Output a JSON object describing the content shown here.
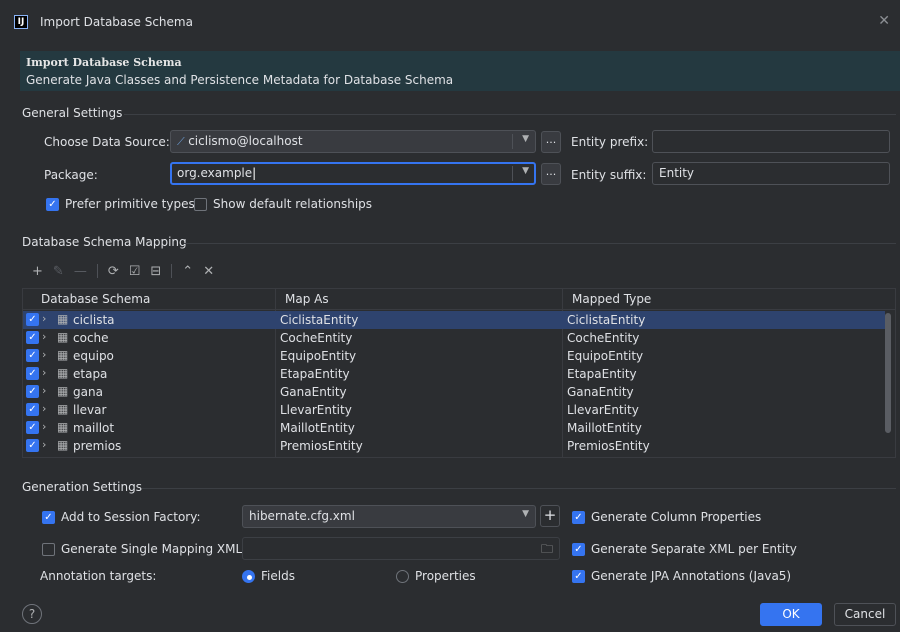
{
  "window": {
    "title": "Import Database Schema",
    "logo": "IJ"
  },
  "banner": {
    "title": "Import Database Schema",
    "description": "Generate Java Classes and Persistence Metadata for Database Schema"
  },
  "general": {
    "section_title": "General Settings",
    "data_source_label": "Choose Data Source:",
    "data_source_value": "ciclismo@localhost",
    "package_label": "Package:",
    "package_value": "org.example",
    "entity_prefix_label": "Entity prefix:",
    "entity_prefix_value": "",
    "entity_suffix_label": "Entity suffix:",
    "entity_suffix_value": "Entity",
    "prefer_primitive_label": "Prefer primitive types",
    "prefer_primitive_checked": true,
    "show_default_rel_label": "Show default relationships",
    "show_default_rel_checked": false,
    "browse_label": "..."
  },
  "mapping": {
    "section_title": "Database Schema Mapping",
    "columns": [
      "Database Schema",
      "Map As",
      "Mapped Type"
    ],
    "rows": [
      {
        "name": "ciclista",
        "map_as": "CiclistaEntity",
        "mapped_type": "CiclistaEntity",
        "checked": true,
        "selected": true
      },
      {
        "name": "coche",
        "map_as": "CocheEntity",
        "mapped_type": "CocheEntity",
        "checked": true,
        "selected": false
      },
      {
        "name": "equipo",
        "map_as": "EquipoEntity",
        "mapped_type": "EquipoEntity",
        "checked": true,
        "selected": false
      },
      {
        "name": "etapa",
        "map_as": "EtapaEntity",
        "mapped_type": "EtapaEntity",
        "checked": true,
        "selected": false
      },
      {
        "name": "gana",
        "map_as": "GanaEntity",
        "mapped_type": "GanaEntity",
        "checked": true,
        "selected": false
      },
      {
        "name": "llevar",
        "map_as": "LlevarEntity",
        "mapped_type": "LlevarEntity",
        "checked": true,
        "selected": false
      },
      {
        "name": "maillot",
        "map_as": "MaillotEntity",
        "mapped_type": "MaillotEntity",
        "checked": true,
        "selected": false
      },
      {
        "name": "premios",
        "map_as": "PremiosEntity",
        "mapped_type": "PremiosEntity",
        "checked": true,
        "selected": false
      }
    ]
  },
  "generation": {
    "section_title": "Generation Settings",
    "add_session_label": "Add to Session Factory:",
    "add_session_checked": true,
    "session_value": "hibernate.cfg.xml",
    "single_mapping_label": "Generate Single Mapping XML:",
    "single_mapping_checked": false,
    "single_mapping_value": "",
    "annotation_targets_label": "Annotation targets:",
    "fields_label": "Fields",
    "properties_label": "Properties",
    "selected_target": "Fields",
    "column_props_label": "Generate Column Properties",
    "separate_xml_label": "Generate Separate XML per Entity",
    "jpa_label": "Generate JPA Annotations (Java5)"
  },
  "footer": {
    "help_label": "?",
    "ok_label": "OK",
    "cancel_label": "Cancel"
  },
  "colors": {
    "accent": "#3574f0",
    "background": "#2b2d30",
    "banner": "#243940",
    "selection": "#2e436e"
  }
}
